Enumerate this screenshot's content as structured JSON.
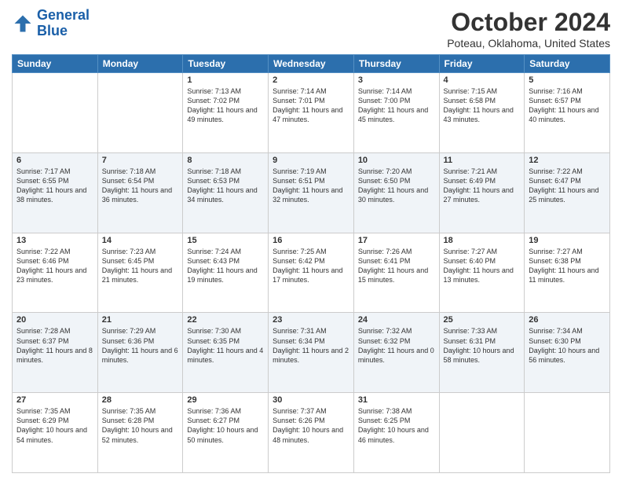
{
  "logo": {
    "line1": "General",
    "line2": "Blue"
  },
  "title": "October 2024",
  "location": "Poteau, Oklahoma, United States",
  "weekdays": [
    "Sunday",
    "Monday",
    "Tuesday",
    "Wednesday",
    "Thursday",
    "Friday",
    "Saturday"
  ],
  "weeks": [
    [
      {
        "day": "",
        "sunrise": "",
        "sunset": "",
        "daylight": ""
      },
      {
        "day": "",
        "sunrise": "",
        "sunset": "",
        "daylight": ""
      },
      {
        "day": "1",
        "sunrise": "Sunrise: 7:13 AM",
        "sunset": "Sunset: 7:02 PM",
        "daylight": "Daylight: 11 hours and 49 minutes."
      },
      {
        "day": "2",
        "sunrise": "Sunrise: 7:14 AM",
        "sunset": "Sunset: 7:01 PM",
        "daylight": "Daylight: 11 hours and 47 minutes."
      },
      {
        "day": "3",
        "sunrise": "Sunrise: 7:14 AM",
        "sunset": "Sunset: 7:00 PM",
        "daylight": "Daylight: 11 hours and 45 minutes."
      },
      {
        "day": "4",
        "sunrise": "Sunrise: 7:15 AM",
        "sunset": "Sunset: 6:58 PM",
        "daylight": "Daylight: 11 hours and 43 minutes."
      },
      {
        "day": "5",
        "sunrise": "Sunrise: 7:16 AM",
        "sunset": "Sunset: 6:57 PM",
        "daylight": "Daylight: 11 hours and 40 minutes."
      }
    ],
    [
      {
        "day": "6",
        "sunrise": "Sunrise: 7:17 AM",
        "sunset": "Sunset: 6:55 PM",
        "daylight": "Daylight: 11 hours and 38 minutes."
      },
      {
        "day": "7",
        "sunrise": "Sunrise: 7:18 AM",
        "sunset": "Sunset: 6:54 PM",
        "daylight": "Daylight: 11 hours and 36 minutes."
      },
      {
        "day": "8",
        "sunrise": "Sunrise: 7:18 AM",
        "sunset": "Sunset: 6:53 PM",
        "daylight": "Daylight: 11 hours and 34 minutes."
      },
      {
        "day": "9",
        "sunrise": "Sunrise: 7:19 AM",
        "sunset": "Sunset: 6:51 PM",
        "daylight": "Daylight: 11 hours and 32 minutes."
      },
      {
        "day": "10",
        "sunrise": "Sunrise: 7:20 AM",
        "sunset": "Sunset: 6:50 PM",
        "daylight": "Daylight: 11 hours and 30 minutes."
      },
      {
        "day": "11",
        "sunrise": "Sunrise: 7:21 AM",
        "sunset": "Sunset: 6:49 PM",
        "daylight": "Daylight: 11 hours and 27 minutes."
      },
      {
        "day": "12",
        "sunrise": "Sunrise: 7:22 AM",
        "sunset": "Sunset: 6:47 PM",
        "daylight": "Daylight: 11 hours and 25 minutes."
      }
    ],
    [
      {
        "day": "13",
        "sunrise": "Sunrise: 7:22 AM",
        "sunset": "Sunset: 6:46 PM",
        "daylight": "Daylight: 11 hours and 23 minutes."
      },
      {
        "day": "14",
        "sunrise": "Sunrise: 7:23 AM",
        "sunset": "Sunset: 6:45 PM",
        "daylight": "Daylight: 11 hours and 21 minutes."
      },
      {
        "day": "15",
        "sunrise": "Sunrise: 7:24 AM",
        "sunset": "Sunset: 6:43 PM",
        "daylight": "Daylight: 11 hours and 19 minutes."
      },
      {
        "day": "16",
        "sunrise": "Sunrise: 7:25 AM",
        "sunset": "Sunset: 6:42 PM",
        "daylight": "Daylight: 11 hours and 17 minutes."
      },
      {
        "day": "17",
        "sunrise": "Sunrise: 7:26 AM",
        "sunset": "Sunset: 6:41 PM",
        "daylight": "Daylight: 11 hours and 15 minutes."
      },
      {
        "day": "18",
        "sunrise": "Sunrise: 7:27 AM",
        "sunset": "Sunset: 6:40 PM",
        "daylight": "Daylight: 11 hours and 13 minutes."
      },
      {
        "day": "19",
        "sunrise": "Sunrise: 7:27 AM",
        "sunset": "Sunset: 6:38 PM",
        "daylight": "Daylight: 11 hours and 11 minutes."
      }
    ],
    [
      {
        "day": "20",
        "sunrise": "Sunrise: 7:28 AM",
        "sunset": "Sunset: 6:37 PM",
        "daylight": "Daylight: 11 hours and 8 minutes."
      },
      {
        "day": "21",
        "sunrise": "Sunrise: 7:29 AM",
        "sunset": "Sunset: 6:36 PM",
        "daylight": "Daylight: 11 hours and 6 minutes."
      },
      {
        "day": "22",
        "sunrise": "Sunrise: 7:30 AM",
        "sunset": "Sunset: 6:35 PM",
        "daylight": "Daylight: 11 hours and 4 minutes."
      },
      {
        "day": "23",
        "sunrise": "Sunrise: 7:31 AM",
        "sunset": "Sunset: 6:34 PM",
        "daylight": "Daylight: 11 hours and 2 minutes."
      },
      {
        "day": "24",
        "sunrise": "Sunrise: 7:32 AM",
        "sunset": "Sunset: 6:32 PM",
        "daylight": "Daylight: 11 hours and 0 minutes."
      },
      {
        "day": "25",
        "sunrise": "Sunrise: 7:33 AM",
        "sunset": "Sunset: 6:31 PM",
        "daylight": "Daylight: 10 hours and 58 minutes."
      },
      {
        "day": "26",
        "sunrise": "Sunrise: 7:34 AM",
        "sunset": "Sunset: 6:30 PM",
        "daylight": "Daylight: 10 hours and 56 minutes."
      }
    ],
    [
      {
        "day": "27",
        "sunrise": "Sunrise: 7:35 AM",
        "sunset": "Sunset: 6:29 PM",
        "daylight": "Daylight: 10 hours and 54 minutes."
      },
      {
        "day": "28",
        "sunrise": "Sunrise: 7:35 AM",
        "sunset": "Sunset: 6:28 PM",
        "daylight": "Daylight: 10 hours and 52 minutes."
      },
      {
        "day": "29",
        "sunrise": "Sunrise: 7:36 AM",
        "sunset": "Sunset: 6:27 PM",
        "daylight": "Daylight: 10 hours and 50 minutes."
      },
      {
        "day": "30",
        "sunrise": "Sunrise: 7:37 AM",
        "sunset": "Sunset: 6:26 PM",
        "daylight": "Daylight: 10 hours and 48 minutes."
      },
      {
        "day": "31",
        "sunrise": "Sunrise: 7:38 AM",
        "sunset": "Sunset: 6:25 PM",
        "daylight": "Daylight: 10 hours and 46 minutes."
      },
      {
        "day": "",
        "sunrise": "",
        "sunset": "",
        "daylight": ""
      },
      {
        "day": "",
        "sunrise": "",
        "sunset": "",
        "daylight": ""
      }
    ]
  ]
}
